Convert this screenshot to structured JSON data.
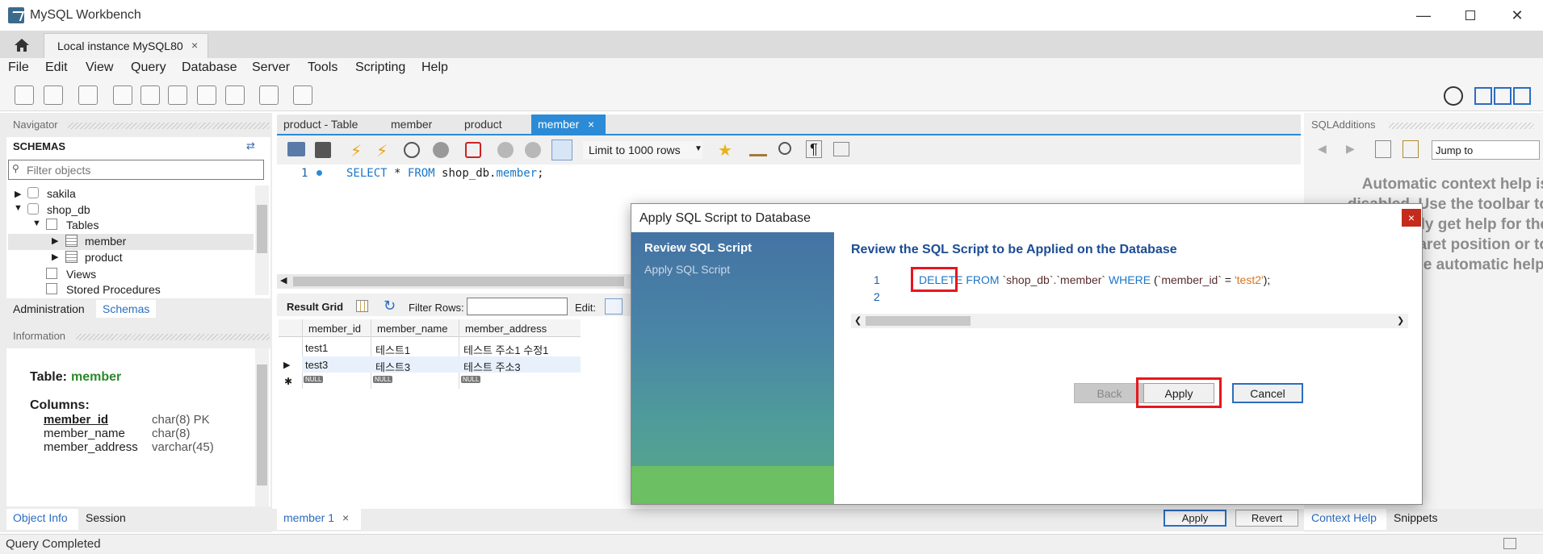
{
  "window": {
    "title": "MySQL Workbench",
    "min_icon": "minimize-icon",
    "max_icon": "maximize-icon",
    "close_icon": "close-icon"
  },
  "tabs": {
    "home_icon": "home-icon",
    "connection_tab": "Local instance MySQL80",
    "close_glyph": "×"
  },
  "menu": [
    "File",
    "Edit",
    "View",
    "Query",
    "Database",
    "Server",
    "Tools",
    "Scripting",
    "Help"
  ],
  "navigator": {
    "header": "Navigator",
    "schemas_label": "SCHEMAS",
    "filter_placeholder": "Filter objects",
    "tree": [
      "sakila",
      "shop_db",
      "Tables",
      "member",
      "product",
      "Views",
      "Stored Procedures"
    ],
    "tabs": [
      "Administration",
      "Schemas"
    ]
  },
  "information": {
    "header": "Information",
    "table_label": "Table:",
    "table_name": "member",
    "columns_label": "Columns:",
    "columns": [
      {
        "name": "member_id",
        "type": "char(8) PK"
      },
      {
        "name": "member_name",
        "type": "char(8)"
      },
      {
        "name": "member_address",
        "type": "varchar(45)"
      }
    ],
    "tabs": [
      "Object Info",
      "Session"
    ]
  },
  "editor": {
    "tabs": [
      "product - Table",
      "member",
      "product",
      "member"
    ],
    "active_tab_close": "×",
    "limit": "Limit to 1000 rows",
    "line_no": "1",
    "sql": {
      "kw1": "SELECT",
      "star": "*",
      "kw2": "FROM",
      "schema": "shop_db.",
      "table": "member",
      "end": ";"
    }
  },
  "results": {
    "label": "Result Grid",
    "filter_label": "Filter Rows:",
    "edit_label": "Edit:",
    "headers": [
      "member_id",
      "member_name",
      "member_address"
    ],
    "rows": [
      [
        "test1",
        "테스트1",
        "테스트 주소1 수정1"
      ],
      [
        "test3",
        "테스트3",
        "테스트 주소3"
      ]
    ],
    "null_tag": "NULL",
    "result_tab": "member 1",
    "apply": "Apply",
    "revert": "Revert"
  },
  "sql_additions": {
    "header": "SQLAdditions",
    "jump_to": "Jump to",
    "help_text": "Automatic context help is disabled. Use the toolbar to manually get help for the current caret position or to toggle automatic help.",
    "tabs": [
      "Context Help",
      "Snippets"
    ]
  },
  "status": {
    "text": "Query Completed"
  },
  "dialog": {
    "title": "Apply SQL Script to Database",
    "close_glyph": "×",
    "steps": [
      "Review SQL Script",
      "Apply SQL Script"
    ],
    "heading": "Review the SQL Script to be Applied on the Database",
    "code": {
      "line1": "1",
      "line2": "2",
      "delete": "DELETE",
      "from": "FROM",
      "target": "`shop_db`.`member`",
      "where": "WHERE",
      "open": "(",
      "col": "`member_id`",
      "eq": "=",
      "val": "'test2'",
      "close": ");"
    },
    "buttons": {
      "back": "Back",
      "apply": "Apply",
      "cancel": "Cancel"
    }
  }
}
